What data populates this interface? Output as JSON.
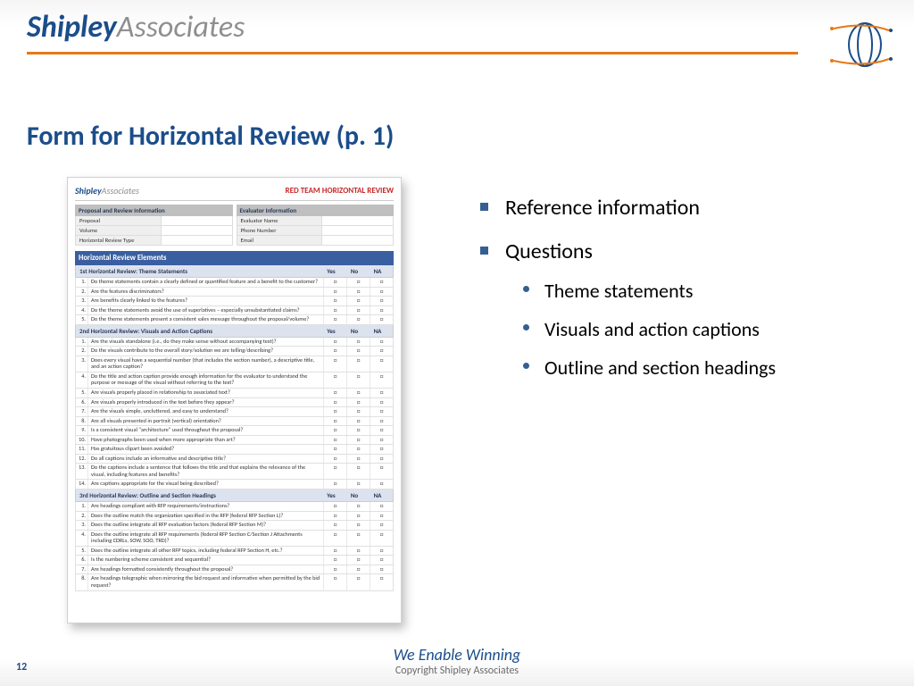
{
  "brand": {
    "strong": "Shipley",
    "light": "Associates"
  },
  "title": "Form for Horizontal Review (p. 1)",
  "bullets": {
    "b1": "Reference information",
    "b2": "Questions",
    "s1": "Theme statements",
    "s2": "Visuals and action captions",
    "s3": "Outline and section headings"
  },
  "footer": {
    "tagline": "We Enable Winning",
    "copyright": "Copyright Shipley Associates"
  },
  "page": "12",
  "form": {
    "title": "RED TEAM HORIZONTAL REVIEW",
    "boxL": {
      "head": "Proposal and Review Information",
      "k1": "Proposal",
      "k2": "Volume",
      "k3": "Horizontal Review Type"
    },
    "boxR": {
      "head": "Evaluator Information",
      "k1": "Evaluator Name",
      "k2": "Phone Number",
      "k3": "Email"
    },
    "band": "Horizontal Review Elements",
    "cols": {
      "yes": "Yes",
      "no": "No",
      "na": "NA"
    },
    "sec1": {
      "head": "1st Horizontal Review:  Theme Statements",
      "q": [
        "Do theme statements contain a clearly defined or quantified feature and a benefit to the customer?",
        "Are the features discriminators?",
        "Are benefits clearly linked to the features?",
        "Do the theme statements avoid the use of superlatives – especially unsubstantiated claims?",
        "Do the theme statements present a consistent sales message throughout the proposal/volume?"
      ]
    },
    "sec2": {
      "head": "2nd Horizontal Review:  Visuals and Action Captions",
      "q": [
        "Are the visuals standalone (i.e., do they make sense without accompanying text)?",
        "Do the visuals contribute to the overall story/solution we are telling/describing?",
        "Does every visual have a sequential number (that includes the section number), a descriptive title, and an action caption?",
        "Do the title and action caption provide enough information for the evaluator to understand the purpose or message of the visual without referring to the text?",
        "Are visuals properly placed in relationship to associated text?",
        "Are visuals properly introduced in the text before they appear?",
        "Are the visuals simple, uncluttered, and easy to understand?",
        "Are all visuals presented in portrait (vertical) orientation?",
        "Is a consistent visual \"architecture\" used throughout the proposal?",
        "Have photographs been used when more appropriate than art?",
        "Has gratuitous clipart been avoided?",
        "Do all captions include an informative and descriptive title?",
        "Do the captions include a sentence that follows the title and that explains the relevance of the visual, including features and benefits?",
        "Are captions appropriate for the visual being described?"
      ]
    },
    "sec3": {
      "head": "3rd Horizontal Review:  Outline and Section Headings",
      "q": [
        "Are headings compliant with RFP requirements/instructions?",
        "Does the outline match the organization specified in the RFP (federal RFP Section L)?",
        "Does the outline integrate all RFP evaluation factors (federal RFP Section M)?",
        "Does the outline integrate all RFP requirements (federal RFP Section C/Section J Attachments including CDRLs, SOW, SOO, TRD)?",
        "Does the outline integrate all other RFP topics, including federal RFP Section H, etc.?",
        "Is the numbering scheme consistent and sequential?",
        "Are headings formatted consistently throughout the proposal?",
        "Are headings telegraphic when mirroring the bid request and informative when permitted by the bid request?"
      ]
    }
  }
}
